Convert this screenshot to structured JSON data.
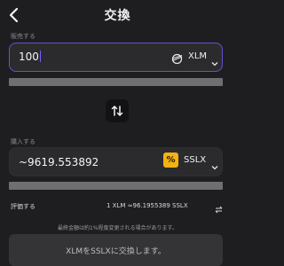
{
  "header": {
    "title": "交換"
  },
  "sell": {
    "label": "販売する",
    "amount": "100",
    "token": "XLM",
    "icon": "stellar-icon"
  },
  "swap": {
    "icon": "swap-arrows-icon"
  },
  "buy": {
    "label": "購入する",
    "amount": "~9619.553892",
    "token": "SSLX",
    "icon": "percent-badge-icon",
    "accent": "#f3b312"
  },
  "rate": {
    "label": "評価する",
    "value": "1 XLM ≈96.1955389 SSLX",
    "icon": "refresh-swap-icon"
  },
  "note": "最終金額は約1%程度変更される場合があります。",
  "submit": {
    "label": "XLMをSSLXに交換します。"
  },
  "colors": {
    "background": "#1e1e20",
    "accent": "#6b4fcf",
    "field": "#2b2b2e"
  }
}
